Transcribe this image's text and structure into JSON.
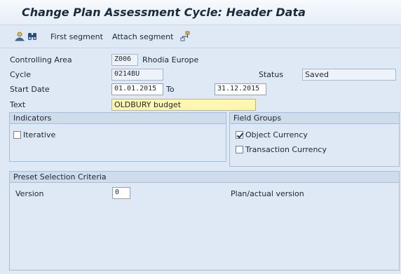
{
  "window": {
    "title": "Change Plan Assessment Cycle: Header Data"
  },
  "toolbar": {
    "items": [
      {
        "icon": "person-icon"
      },
      {
        "icon": "binoculars-icon"
      },
      {
        "label": "First segment"
      },
      {
        "label": "Attach segment"
      },
      {
        "icon": "hierarchy-icon"
      }
    ]
  },
  "header": {
    "controlling_area": {
      "label": "Controlling Area",
      "value": "Z006",
      "desc": "Rhodia Europe"
    },
    "cycle": {
      "label": "Cycle",
      "value": "0214BU"
    },
    "status": {
      "label": "Status",
      "value": "Saved"
    },
    "start_date": {
      "label": "Start Date",
      "value": "01.01.2015",
      "to_label": "To",
      "to_value": "31.12.2015"
    },
    "text": {
      "label": "Text",
      "value": "OLDBURY budget"
    }
  },
  "indicators": {
    "title": "Indicators",
    "iterative": {
      "label": "Iterative",
      "checked": false
    }
  },
  "field_groups": {
    "title": "Field Groups",
    "object_currency": {
      "label": "Object Currency",
      "checked": true
    },
    "transaction_currency": {
      "label": "Transaction Currency",
      "checked": false
    }
  },
  "preset": {
    "title": "Preset Selection Criteria",
    "version": {
      "label": "Version",
      "value": "0",
      "desc": "Plan/actual version"
    }
  },
  "colors": {
    "background": "#dfe9f5",
    "group_header": "#cfdceb",
    "text_field_highlight": "#fff7b0"
  }
}
